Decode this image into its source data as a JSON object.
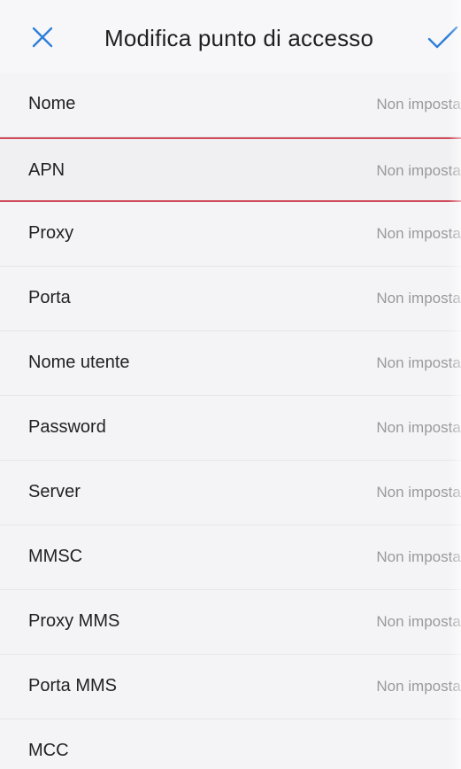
{
  "toolbar": {
    "title": "Modifica punto di accesso",
    "close_icon": "close-icon",
    "confirm_icon": "check-icon",
    "accent_color": "#2f7fd8"
  },
  "fields": [
    {
      "label": "Nome",
      "value": "Non impostato"
    },
    {
      "label": "APN",
      "value": "Non impostato"
    },
    {
      "label": "Proxy",
      "value": "Non impostato"
    },
    {
      "label": "Porta",
      "value": "Non impostato"
    },
    {
      "label": "Nome utente",
      "value": "Non impostato"
    },
    {
      "label": "Password",
      "value": "Non impostato"
    },
    {
      "label": "Server",
      "value": "Non impostato"
    },
    {
      "label": "MMSC",
      "value": "Non impostato"
    },
    {
      "label": "Proxy MMS",
      "value": "Non impostato"
    },
    {
      "label": "Porta MMS",
      "value": "Non impostato"
    },
    {
      "label": "MCC",
      "value": ""
    }
  ],
  "highlight_color": "#d04a5a"
}
